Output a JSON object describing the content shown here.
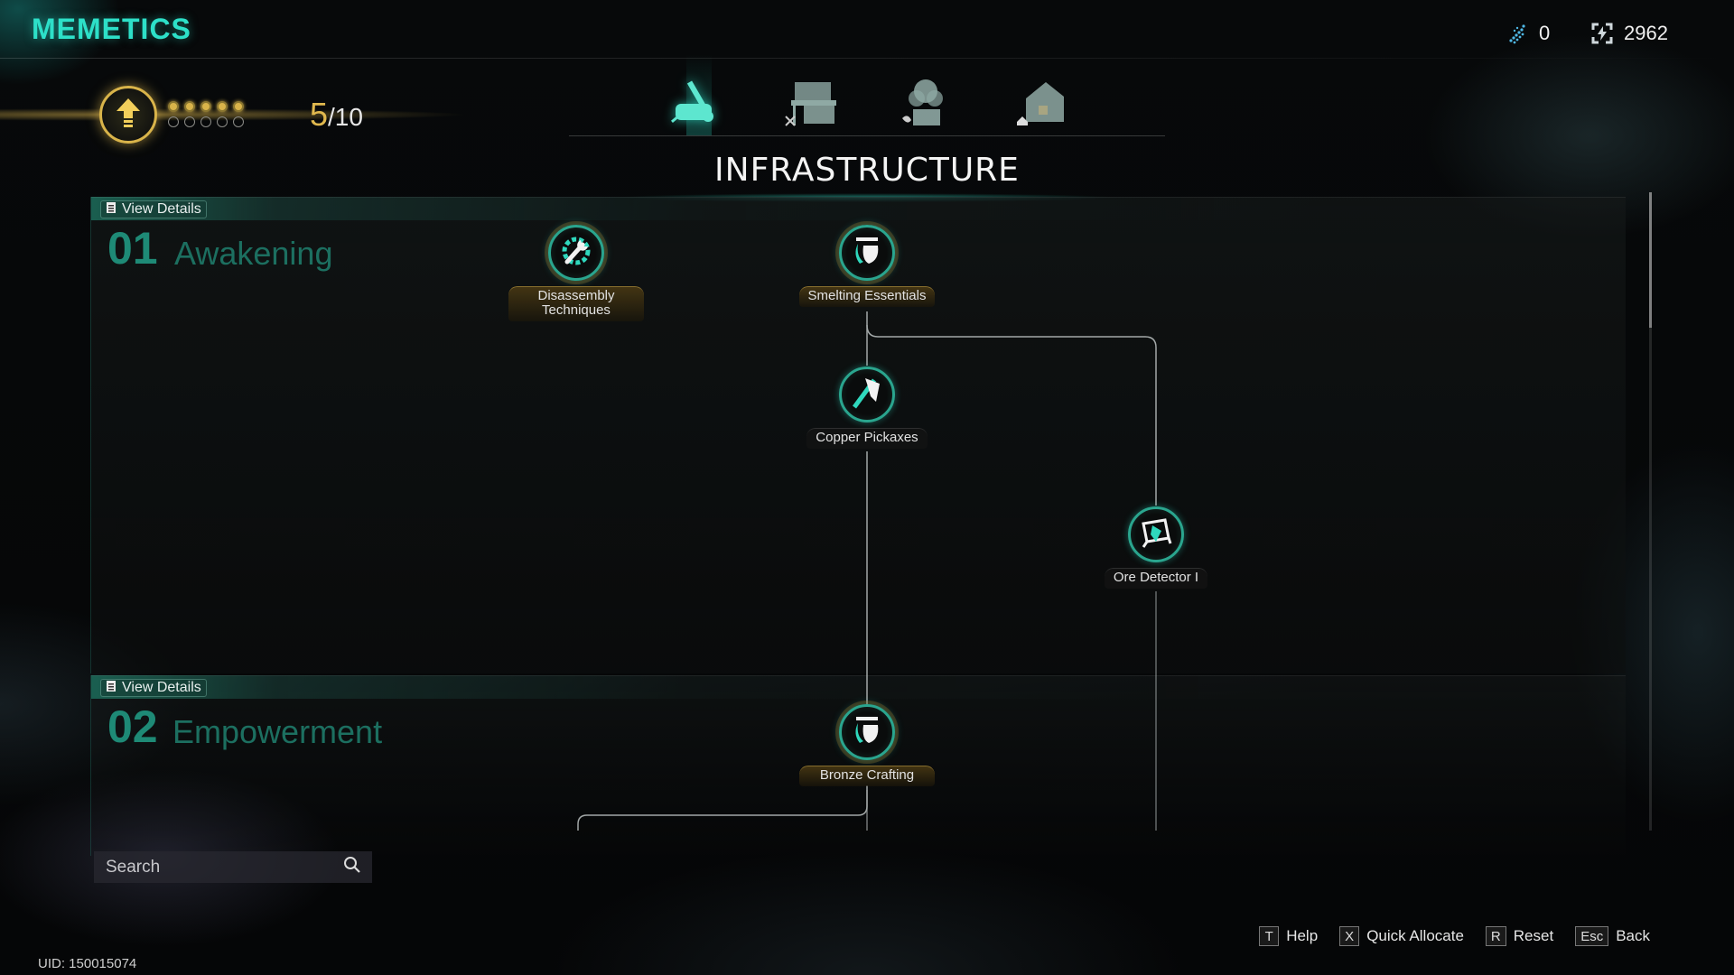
{
  "app": {
    "title": "MEMETICS"
  },
  "currencies": [
    {
      "icon": "meme-shard-icon",
      "value": "0",
      "color": "#4fb8e6"
    },
    {
      "icon": "energy-chip-icon",
      "value": "2962",
      "color": "#cfd8dc"
    }
  ],
  "level": {
    "current": "5",
    "max": "/10",
    "dots_filled": 5,
    "dots_total": 10,
    "accent": "#d9b44a"
  },
  "tabs": [
    {
      "name": "infrastructure",
      "icon": "chainsaw-icon",
      "active": true
    },
    {
      "name": "workbench",
      "icon": "workbench-icon",
      "active": false
    },
    {
      "name": "farming",
      "icon": "plant-icon",
      "active": false
    },
    {
      "name": "housing",
      "icon": "house-icon",
      "active": false
    }
  ],
  "active_tab_title": "INFRASTRUCTURE",
  "sections": [
    {
      "number": "01",
      "name": "Awakening",
      "details_label": "View Details"
    },
    {
      "number": "02",
      "name": "Empowerment",
      "details_label": "View Details"
    }
  ],
  "nodes": [
    {
      "id": "disassembly",
      "label": "Disassembly Techniques",
      "icon": "wrench-gear-icon",
      "style": "gold"
    },
    {
      "id": "smelting",
      "label": "Smelting Essentials",
      "icon": "crucible-icon",
      "style": "gold"
    },
    {
      "id": "copper",
      "label": "Copper Pickaxes",
      "icon": "pickaxe-icon",
      "style": "plain"
    },
    {
      "id": "ore",
      "label": "Ore Detector I",
      "icon": "ore-detector-icon",
      "style": "plain"
    },
    {
      "id": "bronze",
      "label": "Bronze Crafting",
      "icon": "crucible-icon",
      "style": "gold"
    }
  ],
  "search": {
    "placeholder": "Search",
    "value": ""
  },
  "hotkeys": [
    {
      "key": "T",
      "label": "Help"
    },
    {
      "key": "X",
      "label": "Quick Allocate"
    },
    {
      "key": "R",
      "label": "Reset"
    },
    {
      "key": "Esc",
      "label": "Back"
    }
  ],
  "uid": "UID: 150015074",
  "colors": {
    "accent": "#2de0c8",
    "section": "#1e8a76",
    "gold": "#d9b44a"
  }
}
